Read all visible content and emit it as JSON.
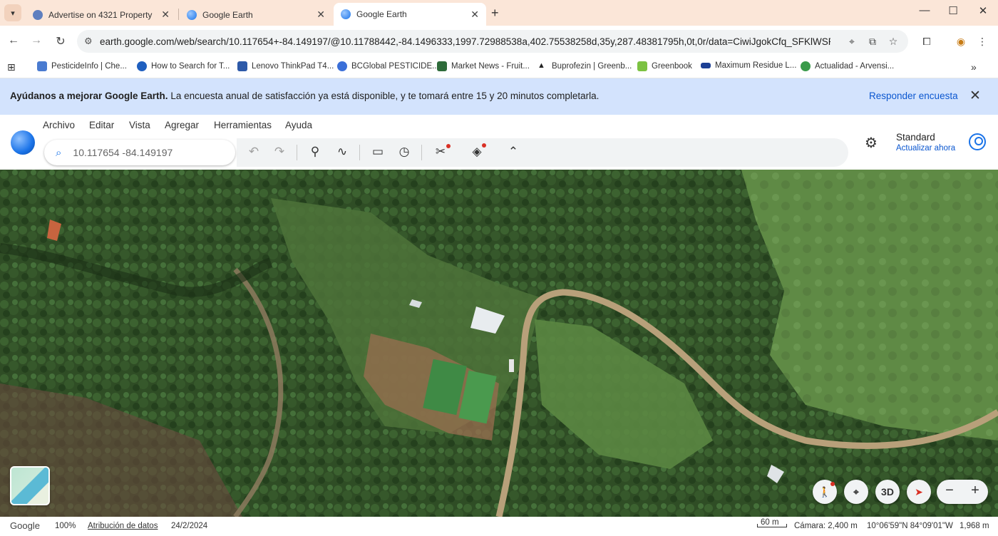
{
  "browser": {
    "tabs": [
      {
        "title": "Advertise on 4321 Property",
        "active": false,
        "favicon_color": "#5f7fbf"
      },
      {
        "title": "Google Earth",
        "active": false,
        "favicon_color": "#1a73e8"
      },
      {
        "title": "Google Earth",
        "active": true,
        "favicon_color": "#1a73e8"
      }
    ],
    "url": "earth.google.com/web/search/10.117654+-84.149197/@10.11788442,-84.1496333,1997.72988538a,402.75538258d,35y,287.48381795h,0t,0r/data=CiwiJgokCfq_SFKlWSRAEW8H55Zh...",
    "bookmarks": [
      {
        "label": "PesticideInfo | Che...",
        "color": "#4a7bd0"
      },
      {
        "label": "How to Search for T...",
        "color": "#1f5fbf"
      },
      {
        "label": "Lenovo ThinkPad T4...",
        "color": "#2d59a8"
      },
      {
        "label": "BCGlobal PESTICIDE...",
        "color": "#3b6fd8"
      },
      {
        "label": "Market News - Fruit...",
        "color": "#2e6b3a"
      },
      {
        "label": "Buprofezin | Greenb...",
        "color": "#222222"
      },
      {
        "label": "Greenbook",
        "color": "#7cc242"
      },
      {
        "label": "Maximum Residue L...",
        "color": "#1c3f94"
      },
      {
        "label": "Actualidad - Arvensi...",
        "color": "#3a9a4a"
      }
    ]
  },
  "banner": {
    "bold": "Ayúdanos a mejorar Google Earth.",
    "text": " La encuesta anual de satisfacción ya está disponible, y te tomará entre 15 y 20 minutos completarla.",
    "action": "Responder encuesta"
  },
  "earth": {
    "menu": [
      "Archivo",
      "Editar",
      "Vista",
      "Agregar",
      "Herramientas",
      "Ayuda"
    ],
    "search_value": "10.117654 -84.149197",
    "plan_name": "Standard",
    "upgrade_label": "Actualizar ahora",
    "map_button_3d": "3D"
  },
  "status": {
    "google": "Google",
    "zoom": "100%",
    "attribution": "Atribución de datos",
    "date": "24/2/2024",
    "scale": "60 m",
    "camera": "Cámara: 2,400 m",
    "coords": "10°06'59\"N 84°09'01\"W",
    "elevation": "1,968 m"
  },
  "colors": {
    "banner_bg": "#d3e3fd",
    "link": "#0b57d0",
    "tabstrip_bg": "#fbe6d8",
    "notify_dot": "#d93025"
  }
}
